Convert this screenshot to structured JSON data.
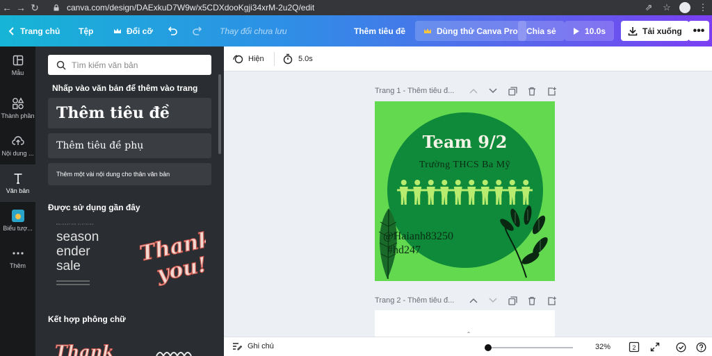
{
  "browser": {
    "url": "canva.com/design/DAExkuD7W9w/x5CDXdooKgji34xrM-2u2Q/edit"
  },
  "topbar": {
    "home": "Trang chủ",
    "file": "Tệp",
    "resize": "Đổi cỡ",
    "save_status": "Thay đổi chưa lưu",
    "title": "Thêm tiêu đề",
    "pro": "Dùng thử Canva Pro",
    "share": "Chia sẻ",
    "play": "10.0s",
    "download": "Tải xuống"
  },
  "rail": {
    "items": [
      {
        "label": "Mẫu",
        "icon": "template-icon"
      },
      {
        "label": "Thành phần",
        "icon": "elements-icon"
      },
      {
        "label": "Nội dung ...",
        "icon": "upload-icon"
      },
      {
        "label": "Văn bản",
        "icon": "text-icon"
      },
      {
        "label": "Biểu tượ...",
        "icon": "brand-logo-icon"
      },
      {
        "label": "Thêm",
        "icon": "more-icon"
      }
    ]
  },
  "panel": {
    "search_placeholder": "Tìm kiếm văn bản",
    "hint": "Nhấp vào văn bản để thêm vào trang",
    "heading": "Thêm tiêu đề",
    "subheading": "Thêm tiêu đề phụ",
    "body": "Thêm một vài nội dung cho thân văn bản",
    "recent_title": "Được sử dụng gần đây",
    "combo_title": "Kết hợp phông chữ",
    "season_small": "RELEGATION CLOTHING",
    "season_lines": [
      "season",
      "ender",
      "sale"
    ],
    "thanks_lines": [
      "Thank",
      "you!"
    ]
  },
  "editor": {
    "animate": "Hiện",
    "duration": "5.0s",
    "page1_label": "Trang 1 - Thêm tiêu đ...",
    "page2_label": "Trang 2 - Thêm tiêu đ...",
    "notes": "Ghi chú",
    "zoom": "32%",
    "zoom_fraction": 0.32,
    "page_count": "2"
  },
  "design": {
    "title": "Team 9/2",
    "school": "Trường THCS Ba Mỹ",
    "handle": "@Haianh83250",
    "hashtag": "#hd247",
    "people_count": 10,
    "colors": {
      "bg": "#62d94f",
      "circle": "#0f8a3a",
      "figure": "#b7ec6e"
    }
  }
}
